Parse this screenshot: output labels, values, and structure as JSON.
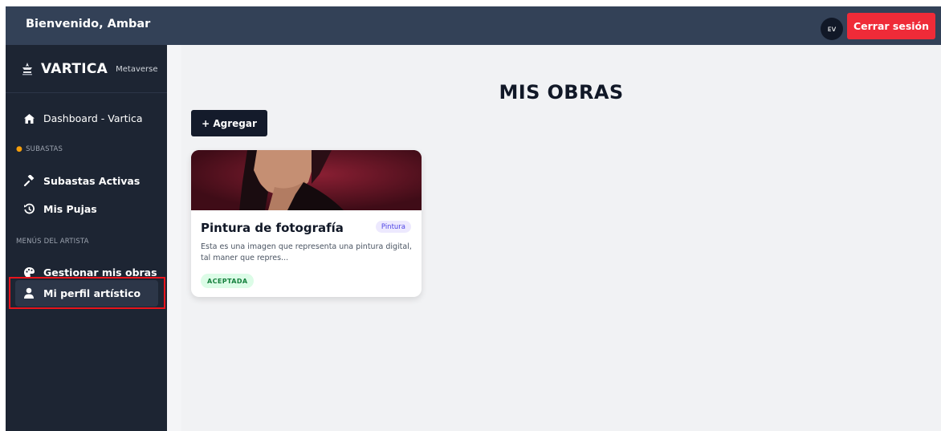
{
  "header": {
    "welcome": "Bienvenido, Ambar",
    "avatar_initials": "ᴇᴠ",
    "logout_label": "Cerrar sesión"
  },
  "sidebar": {
    "brand_name": "VARTICA",
    "brand_sub": "Metaverse",
    "dashboard_label": "Dashboard - Vartica",
    "section_subastas": "SUBASTAS",
    "subastas_activas": "Subastas Activas",
    "mis_pujas": "Mis Pujas",
    "section_artista": "MENÚS DEL ARTISTA",
    "gestionar_obras": "Gestionar mis obras",
    "mi_perfil": "Mi perfil artístico"
  },
  "main": {
    "title": "MIS OBRAS",
    "add_label": "+ Agregar",
    "card": {
      "title": "Pintura de fotografía",
      "tag": "Pintura",
      "description": "Esta es una imagen que representa una pintura digital, tal maner que repres...",
      "status": "ACEPTADA"
    }
  },
  "colors": {
    "topbar": "#334157",
    "sidebar": "#1d2533",
    "logout": "#ef2b38",
    "accent_dark": "#141b2b"
  }
}
